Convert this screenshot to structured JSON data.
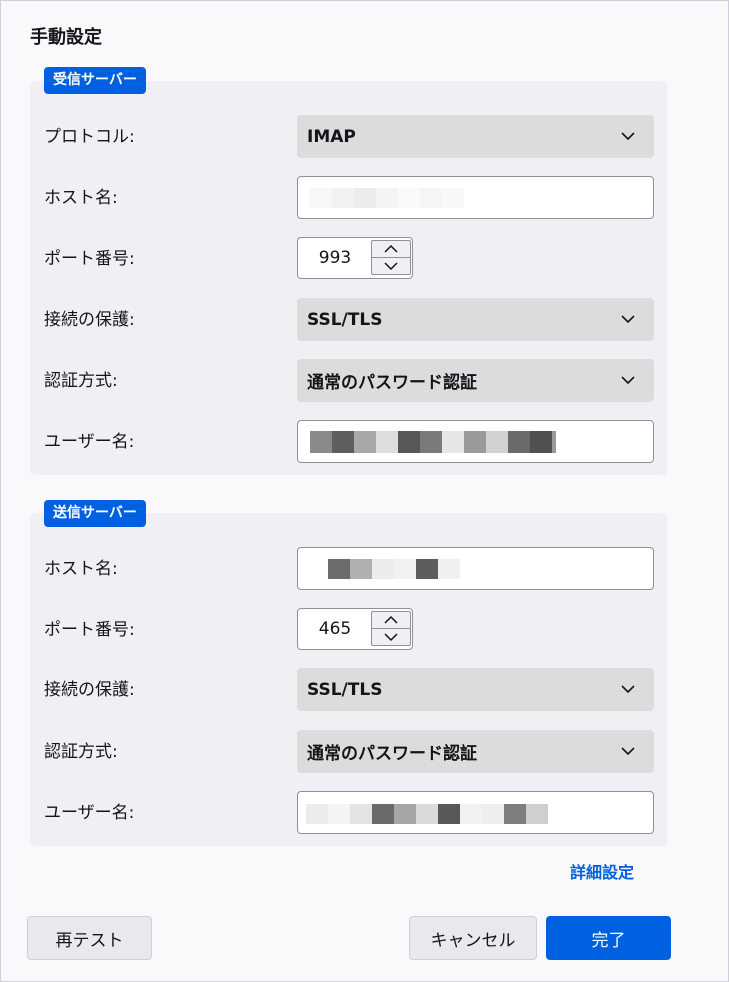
{
  "dialog": {
    "title": "手動設定"
  },
  "incoming": {
    "badge": "受信サーバー",
    "protocol": {
      "label": "プロトコル:",
      "value": "IMAP"
    },
    "hostname": {
      "label": "ホスト名:"
    },
    "port": {
      "label": "ポート番号:",
      "value": "993"
    },
    "security": {
      "label": "接続の保護:",
      "value": "SSL/TLS"
    },
    "auth": {
      "label": "認証方式:",
      "value": "通常のパスワード認証"
    },
    "username": {
      "label": "ユーザー名:"
    }
  },
  "outgoing": {
    "badge": "送信サーバー",
    "hostname": {
      "label": "ホスト名:"
    },
    "port": {
      "label": "ポート番号:",
      "value": "465"
    },
    "security": {
      "label": "接続の保護:",
      "value": "SSL/TLS"
    },
    "auth": {
      "label": "認証方式:",
      "value": "通常のパスワード認証"
    },
    "username": {
      "label": "ユーザー名:"
    }
  },
  "advanced_link": "詳細設定",
  "buttons": {
    "retest": "再テスト",
    "cancel": "キャンセル",
    "done": "完了"
  },
  "colors": {
    "accent": "#0061e0",
    "section_bg": "#f0f0f4",
    "select_bg": "#dcdcdc"
  }
}
